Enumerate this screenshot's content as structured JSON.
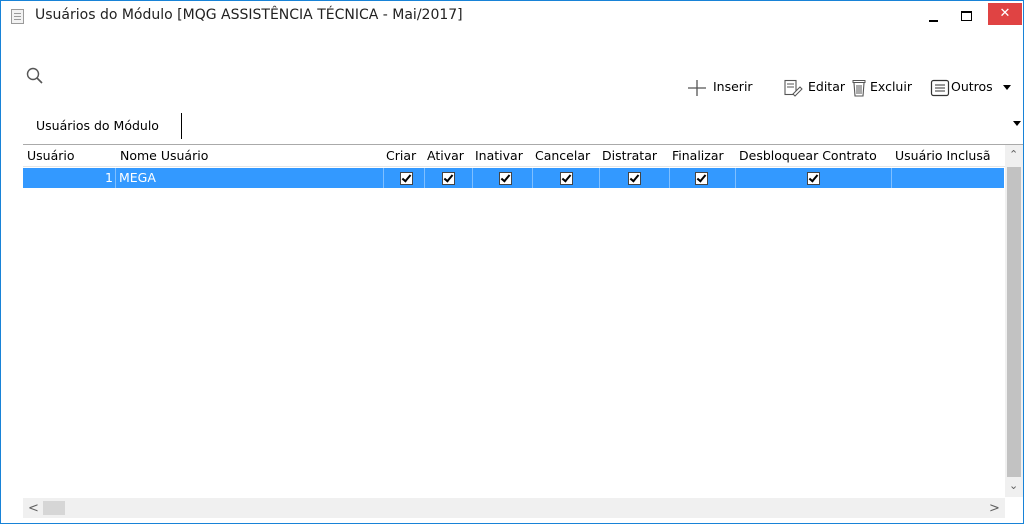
{
  "window": {
    "title": "Usuários do Módulo [MQG ASSISTÊNCIA TÉCNICA - Mai/2017]",
    "close_label": "✕"
  },
  "toolbar": {
    "inserir": "Inserir",
    "editar": "Editar",
    "excluir": "Excluir",
    "outros": "Outros"
  },
  "tab": {
    "label": "Usuários do Módulo"
  },
  "grid": {
    "columns": [
      "Usuário",
      "Nome Usuário",
      "Criar",
      "Ativar",
      "Inativar",
      "Cancelar",
      "Distratar",
      "Finalizar",
      "Desbloquear Contrato",
      "Usuário Inclusã"
    ],
    "rows": [
      {
        "usuario": "1",
        "nome": "MEGA",
        "criar": true,
        "ativar": true,
        "inativar": true,
        "cancelar": true,
        "distratar": true,
        "finalizar": true,
        "desbloquear_contrato": true,
        "usuario_inclusao": ""
      }
    ]
  },
  "icons": {
    "search": "search-icon",
    "insert": "plus-icon",
    "edit": "edit-icon",
    "delete": "trash-icon",
    "others": "list-icon"
  },
  "colors": {
    "selection": "#3399ff",
    "close_button": "#e04343",
    "window_border": "#1883d7"
  }
}
